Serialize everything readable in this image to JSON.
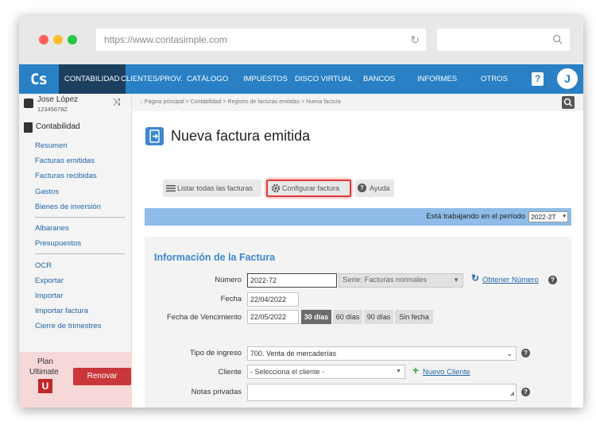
{
  "browser": {
    "url": "https://www.contasimple.com"
  },
  "topnav": {
    "logo": "Cs",
    "items": [
      "CONTABILIDAD",
      "CLIENTES/PROV.",
      "CATÁLOGO",
      "IMPUESTOS",
      "DISCO VIRTUAL",
      "BANCOS",
      "INFORMES",
      "OTROS"
    ],
    "help": "?",
    "avatar_initial": "J",
    "accent": "#2980c4",
    "active_bg": "#1c3f5f"
  },
  "user": {
    "name": "Jose López",
    "id": "12345678Z"
  },
  "sidebar": {
    "section_title": "Contabilidad",
    "group1": [
      "Resumen",
      "Facturas emitidas",
      "Facturas recibidas",
      "Gastos",
      "Bienes de inversión"
    ],
    "group2": [
      "Albaranes",
      "Presupuestos"
    ],
    "group3": [
      "OCR",
      "Exportar",
      "Importar",
      "Importar factura",
      "Cierre de trimestres"
    ]
  },
  "plan": {
    "label1": "Plan",
    "label2": "Ultimate",
    "badge": "U",
    "renew_label": "Renovar"
  },
  "breadcrumb": ":: Página principal > Contabilidad > Registro de facturas emitidas > Nueva factura",
  "page_title": "Nueva factura emitida",
  "toolbar": {
    "list_label": "Listar todas las facturas",
    "config_label": "Configurar factura",
    "help_label": "Ayuda"
  },
  "period": {
    "label": "Está trabajando en el período",
    "value": "2022-2T"
  },
  "form": {
    "section_title": "Información de la Factura",
    "numero_label": "Número",
    "numero_value": "2022-72",
    "serie_value": "Serie: Facturas normales",
    "obtener_label": "Obtener Número",
    "fecha_label": "Fecha",
    "fecha_value": "22/04/2022",
    "venc_label": "Fecha de Vencimiento",
    "venc_value": "22/05/2022",
    "venc_options": [
      "30 días",
      "60 días",
      "90 días",
      "Sin fecha"
    ],
    "tipo_label": "Tipo de ingreso",
    "tipo_value": "700. Venta de mercaderías",
    "cliente_label": "Cliente",
    "cliente_value": "- Selecciona el cliente -",
    "nuevo_cliente_label": "Nuevo Cliente",
    "notas_label": "Notas privadas"
  }
}
